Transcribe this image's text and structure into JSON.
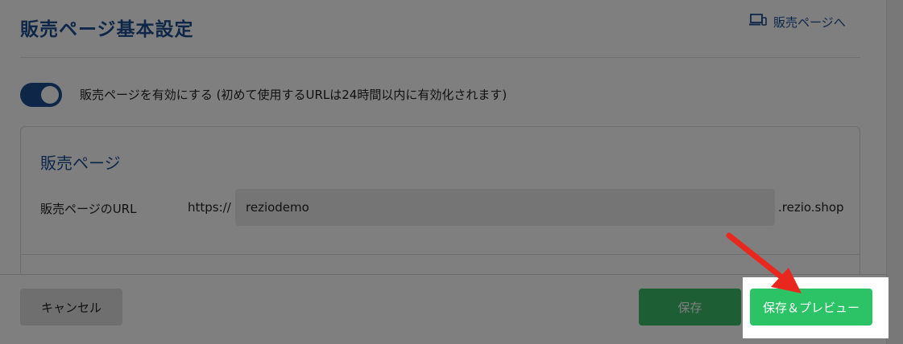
{
  "header": {
    "title": "販売ページ基本設定",
    "to_sales_page_label": "販売ページへ"
  },
  "enable": {
    "label": "販売ページを有効にする (初めて使用するURLは24時間以内に有効化されます)",
    "enabled": true
  },
  "card": {
    "title": "販売ページ",
    "url_label": "販売ページのURL",
    "url_prefix": "https://",
    "url_value": "reziodemo",
    "url_suffix": ".rezio.shop"
  },
  "footer": {
    "cancel_label": "キャンセル",
    "save_label": "保存",
    "save_preview_label": "保存＆プレビュー"
  },
  "colors": {
    "brand_blue": "#1d4f91",
    "green": "#2cc366",
    "annotation_red": "#e8281e"
  }
}
